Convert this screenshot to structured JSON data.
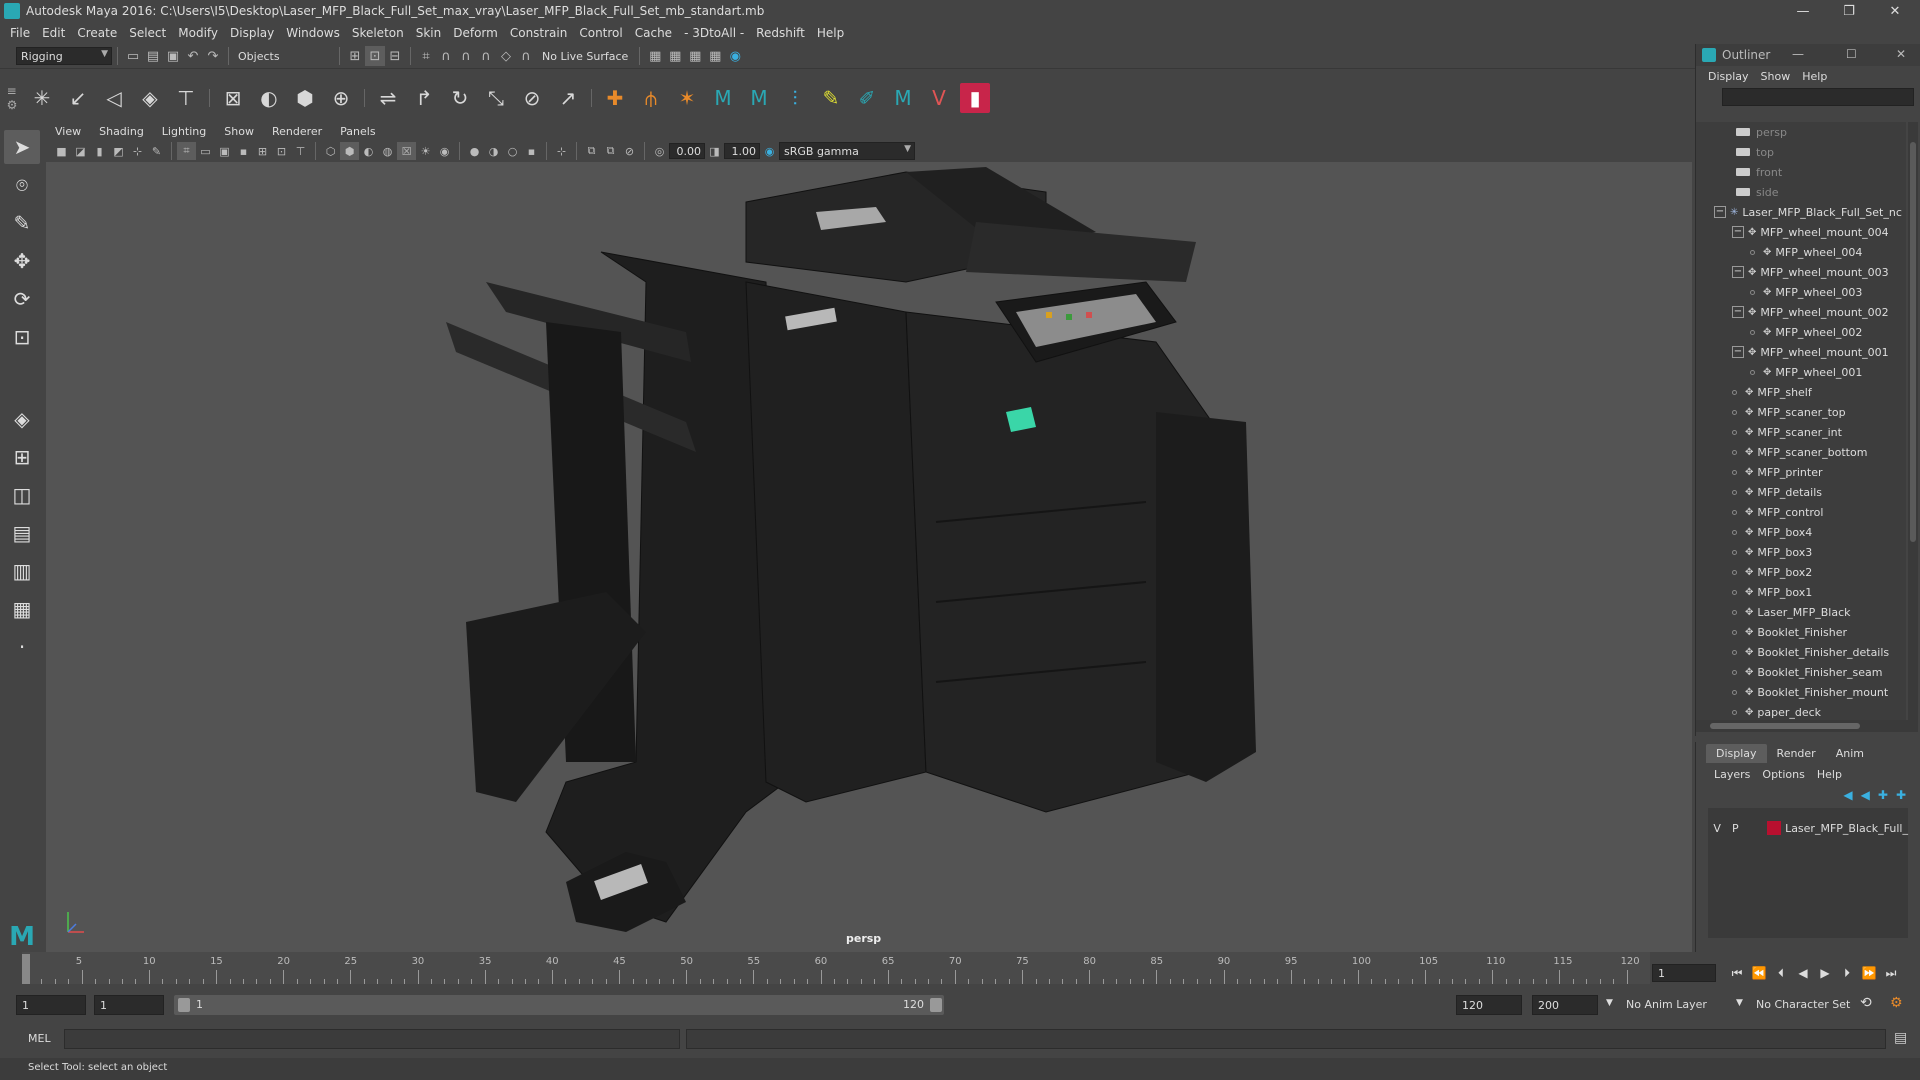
{
  "window": {
    "title": "Autodesk Maya 2016: C:\\Users\\I5\\Desktop\\Laser_MFP_Black_Full_Set_max_vray\\Laser_MFP_Black_Full_Set_mb_standart.mb",
    "controls": [
      "—",
      "❐",
      "✕"
    ]
  },
  "menubar": [
    "File",
    "Edit",
    "Create",
    "Select",
    "Modify",
    "Display",
    "Windows",
    "Skeleton",
    "Skin",
    "Deform",
    "Constrain",
    "Control",
    "Cache",
    "- 3DtoAll -",
    "Redshift",
    "Help"
  ],
  "statusline": {
    "menuset": "Rigging",
    "selection_mode": "Objects",
    "live_surface": "No Live Surface"
  },
  "viewport": {
    "menu": [
      "View",
      "Shading",
      "Lighting",
      "Show",
      "Renderer",
      "Panels"
    ],
    "exposure": "0.00",
    "gamma": "1.00",
    "color_space": "sRGB gamma",
    "camera_label": "persp"
  },
  "outliner": {
    "title": "Outliner",
    "menu": [
      "Display",
      "Show",
      "Help"
    ],
    "cameras": [
      "persp",
      "top",
      "front",
      "side"
    ],
    "root": "Laser_MFP_Black_Full_Set_nc",
    "wheel_groups": [
      {
        "mount": "MFP_wheel_mount_004",
        "child": "MFP_wheel_004"
      },
      {
        "mount": "MFP_wheel_mount_003",
        "child": "MFP_wheel_003"
      },
      {
        "mount": "MFP_wheel_mount_002",
        "child": "MFP_wheel_002"
      },
      {
        "mount": "MFP_wheel_mount_001",
        "child": "MFP_wheel_001"
      }
    ],
    "items": [
      "MFP_shelf",
      "MFP_scaner_top",
      "MFP_scaner_int",
      "MFP_scaner_bottom",
      "MFP_printer",
      "MFP_details",
      "MFP_control",
      "MFP_box4",
      "MFP_box3",
      "MFP_box2",
      "MFP_box1",
      "Laser_MFP_Black",
      "Booklet_Finisher",
      "Booklet_Finisher_details",
      "Booklet_Finisher_seam",
      "Booklet_Finisher_mount",
      "paper_deck"
    ]
  },
  "layers": {
    "tabs": [
      "Display",
      "Render",
      "Anim"
    ],
    "menu": [
      "Layers",
      "Options",
      "Help"
    ],
    "row": {
      "v": "V",
      "p": "P",
      "name": "Laser_MFP_Black_Full_",
      "color": "#b8102f"
    }
  },
  "timeline": {
    "ticks": [
      "5",
      "10",
      "15",
      "20",
      "25",
      "30",
      "35",
      "40",
      "45",
      "50",
      "55",
      "60",
      "65",
      "70",
      "75",
      "80",
      "85",
      "90",
      "95",
      "100",
      "105",
      "110",
      "115",
      "120"
    ],
    "start_label": "1",
    "current_frame": "1"
  },
  "range": {
    "start": "1",
    "playback_start": "1",
    "slider_left": "1",
    "slider_right": "120",
    "playback_end": "120",
    "end": "200",
    "anim_layer": "No Anim Layer",
    "character_set": "No Character Set"
  },
  "cmdline": {
    "label": "MEL"
  },
  "helpline": {
    "text": "Select Tool: select an object"
  }
}
